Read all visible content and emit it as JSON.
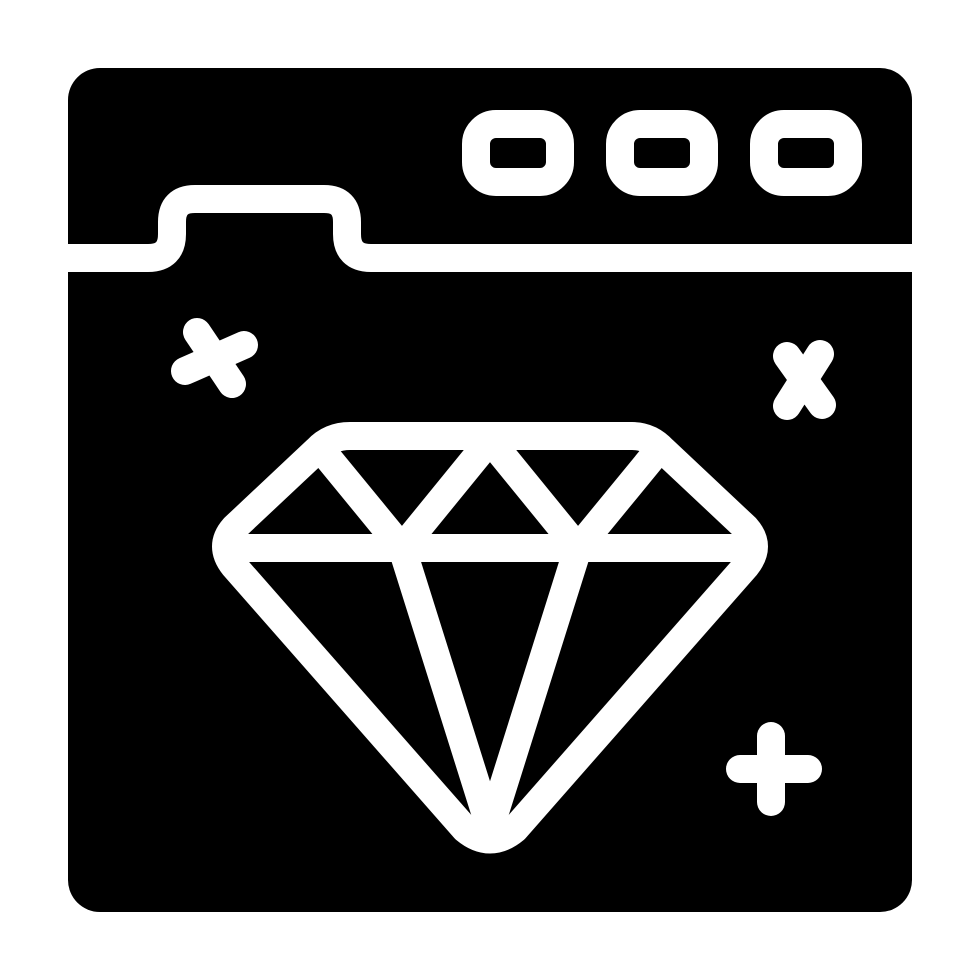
{
  "icon": {
    "name": "browser-window-diamond-icon",
    "colors": {
      "background": "#ffffff",
      "fill": "#000000",
      "line": "#ffffff"
    },
    "window_buttons": [
      "window-button-icon",
      "window-button-icon",
      "window-button-icon"
    ],
    "sparkles": [
      "sparkle-x-icon",
      "sparkle-x-icon",
      "sparkle-plus-icon"
    ]
  }
}
